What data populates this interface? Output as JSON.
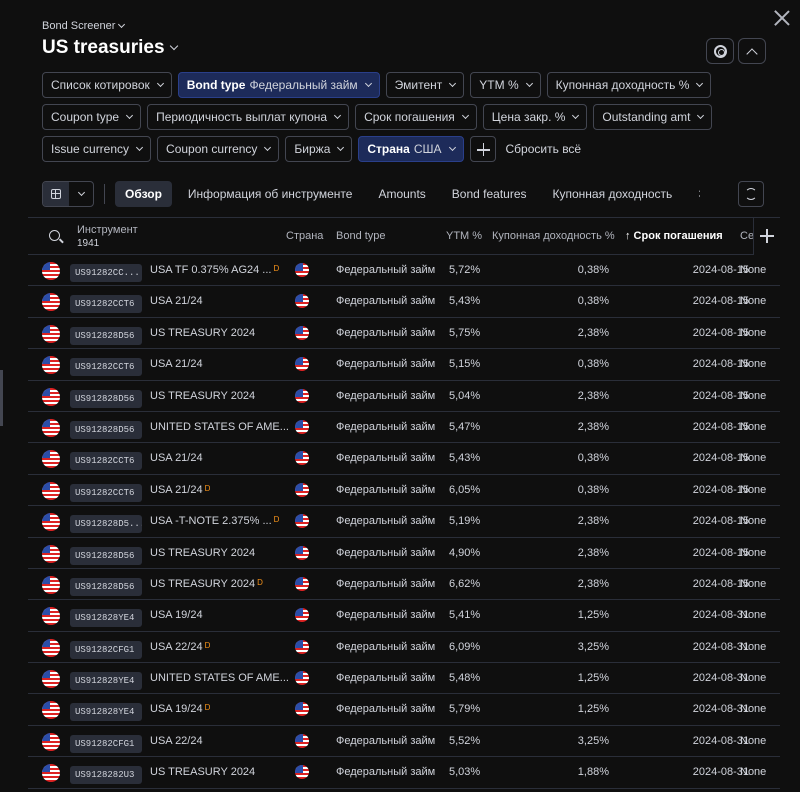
{
  "header": {
    "breadcrumb": "Bond Screener",
    "title": "US treasuries"
  },
  "filters": {
    "row1": [
      {
        "label": "Список котировок",
        "value": "",
        "active": false
      },
      {
        "label": "Bond type",
        "value": "Федеральный займ",
        "active": true
      },
      {
        "label": "Эмитент",
        "value": "",
        "active": false
      },
      {
        "label": "YTM %",
        "value": "",
        "active": false
      },
      {
        "label": "Купонная доходность %",
        "value": "",
        "active": false
      }
    ],
    "row2": [
      {
        "label": "Coupon type",
        "value": "",
        "active": false
      },
      {
        "label": "Периодичность выплат купона",
        "value": "",
        "active": false
      },
      {
        "label": "Срок погашения",
        "value": "",
        "active": false
      },
      {
        "label": "Цена закр. %",
        "value": "",
        "active": false
      },
      {
        "label": "Outstanding amt",
        "value": "",
        "active": false
      }
    ],
    "row3": [
      {
        "label": "Issue currency",
        "value": "",
        "active": false
      },
      {
        "label": "Coupon currency",
        "value": "",
        "active": false
      },
      {
        "label": "Биржа",
        "value": "",
        "active": false
      },
      {
        "label": "Страна",
        "value": "США",
        "active": true
      }
    ],
    "reset_label": "Сбросить всё"
  },
  "tabs": [
    "Обзор",
    "Информация об инструменте",
    "Amounts",
    "Bond features",
    "Купонная доходность",
    "Эм"
  ],
  "table": {
    "headers": {
      "instrument": "Инструмент",
      "count": "1941",
      "country": "Страна",
      "bond_type": "Bond type",
      "ytm": "YTM %",
      "coupon": "Купонная доходность %",
      "maturity": "↑ Срок погашения",
      "extra": "Се"
    },
    "rows": [
      {
        "isin": "US91282CC...",
        "name": "USA TF 0.375% AG24 ...",
        "d": "D",
        "btype": "Федеральный займ",
        "ytm": "5,72%",
        "coupon": "0,38%",
        "maturity": "2024-08-15",
        "extra": "None"
      },
      {
        "isin": "US91282CCT6",
        "name": "USA 21/24",
        "d": "",
        "btype": "Федеральный займ",
        "ytm": "5,43%",
        "coupon": "0,38%",
        "maturity": "2024-08-15",
        "extra": "None"
      },
      {
        "isin": "US912828D56",
        "name": "US TREASURY 2024",
        "d": "",
        "btype": "Федеральный займ",
        "ytm": "5,75%",
        "coupon": "2,38%",
        "maturity": "2024-08-15",
        "extra": "None"
      },
      {
        "isin": "US91282CCT6",
        "name": "USA 21/24",
        "d": "",
        "btype": "Федеральный займ",
        "ytm": "5,15%",
        "coupon": "0,38%",
        "maturity": "2024-08-15",
        "extra": "None"
      },
      {
        "isin": "US912828D56",
        "name": "US TREASURY 2024",
        "d": "",
        "btype": "Федеральный займ",
        "ytm": "5,04%",
        "coupon": "2,38%",
        "maturity": "2024-08-15",
        "extra": "None"
      },
      {
        "isin": "US912828D56",
        "name": "UNITED STATES OF AME...",
        "d": "",
        "btype": "Федеральный займ",
        "ytm": "5,47%",
        "coupon": "2,38%",
        "maturity": "2024-08-15",
        "extra": "None"
      },
      {
        "isin": "US91282CCT6",
        "name": "USA 21/24",
        "d": "",
        "btype": "Федеральный займ",
        "ytm": "5,43%",
        "coupon": "0,38%",
        "maturity": "2024-08-15",
        "extra": "None"
      },
      {
        "isin": "US91282CCT6",
        "name": "USA 21/24",
        "d": "D",
        "btype": "Федеральный займ",
        "ytm": "6,05%",
        "coupon": "0,38%",
        "maturity": "2024-08-15",
        "extra": "None"
      },
      {
        "isin": "US912828D5...",
        "name": "USA -T-NOTE 2.375% ...",
        "d": "D",
        "btype": "Федеральный займ",
        "ytm": "5,19%",
        "coupon": "2,38%",
        "maturity": "2024-08-15",
        "extra": "None"
      },
      {
        "isin": "US912828D56",
        "name": "US TREASURY 2024",
        "d": "",
        "btype": "Федеральный займ",
        "ytm": "4,90%",
        "coupon": "2,38%",
        "maturity": "2024-08-15",
        "extra": "None"
      },
      {
        "isin": "US912828D56",
        "name": "US TREASURY 2024",
        "d": "D",
        "btype": "Федеральный займ",
        "ytm": "6,62%",
        "coupon": "2,38%",
        "maturity": "2024-08-15",
        "extra": "None"
      },
      {
        "isin": "US912828YE4",
        "name": "USA 19/24",
        "d": "",
        "btype": "Федеральный займ",
        "ytm": "5,41%",
        "coupon": "1,25%",
        "maturity": "2024-08-31",
        "extra": "None"
      },
      {
        "isin": "US91282CFG1",
        "name": "USA 22/24",
        "d": "D",
        "btype": "Федеральный займ",
        "ytm": "6,09%",
        "coupon": "3,25%",
        "maturity": "2024-08-31",
        "extra": "None"
      },
      {
        "isin": "US912828YE4",
        "name": "UNITED STATES OF AME...",
        "d": "",
        "btype": "Федеральный займ",
        "ytm": "5,48%",
        "coupon": "1,25%",
        "maturity": "2024-08-31",
        "extra": "None"
      },
      {
        "isin": "US912828YE4",
        "name": "USA 19/24",
        "d": "D",
        "btype": "Федеральный займ",
        "ytm": "5,79%",
        "coupon": "1,25%",
        "maturity": "2024-08-31",
        "extra": "None"
      },
      {
        "isin": "US91282CFG1",
        "name": "USA 22/24",
        "d": "",
        "btype": "Федеральный займ",
        "ytm": "5,52%",
        "coupon": "3,25%",
        "maturity": "2024-08-31",
        "extra": "None"
      },
      {
        "isin": "US9128282U3",
        "name": "US TREASURY 2024",
        "d": "",
        "btype": "Федеральный займ",
        "ytm": "5,03%",
        "coupon": "1,88%",
        "maturity": "2024-08-31",
        "extra": "None"
      }
    ]
  }
}
